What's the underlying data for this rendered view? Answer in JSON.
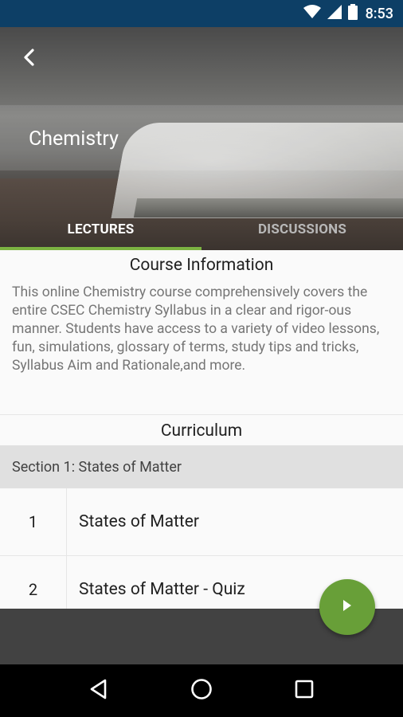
{
  "status_bar": {
    "time": "8:53"
  },
  "header": {
    "title": "Chemistry"
  },
  "tabs": [
    {
      "label": "LECTURES",
      "active": true
    },
    {
      "label": "DISCUSSIONS",
      "active": false
    }
  ],
  "course_info": {
    "heading": "Course Information",
    "description": "This online Chemistry course comprehensively covers the entire CSEC Chemistry Syllabus in a clear and rigor-ous manner. Students have access to a variety of video lessons, fun, simulations, glossary of terms, study tips and tricks, Syllabus Aim and Rationale,and more."
  },
  "curriculum": {
    "heading": "Curriculum",
    "sections": [
      {
        "title": "Section 1: States of Matter",
        "lessons": [
          {
            "number": "1",
            "title": "States of Matter"
          },
          {
            "number": "2",
            "title": "States of Matter - Quiz"
          }
        ]
      }
    ]
  },
  "colors": {
    "status_bar": "#0d3f66",
    "accent": "#7cb342",
    "fab": "#689f38",
    "bottom_bar": "#424242"
  },
  "icons": {
    "back": "chevron-left-icon",
    "fab": "play-icon",
    "nav_back": "triangle-back-icon",
    "nav_home": "circle-home-icon",
    "nav_recents": "square-recents-icon"
  }
}
